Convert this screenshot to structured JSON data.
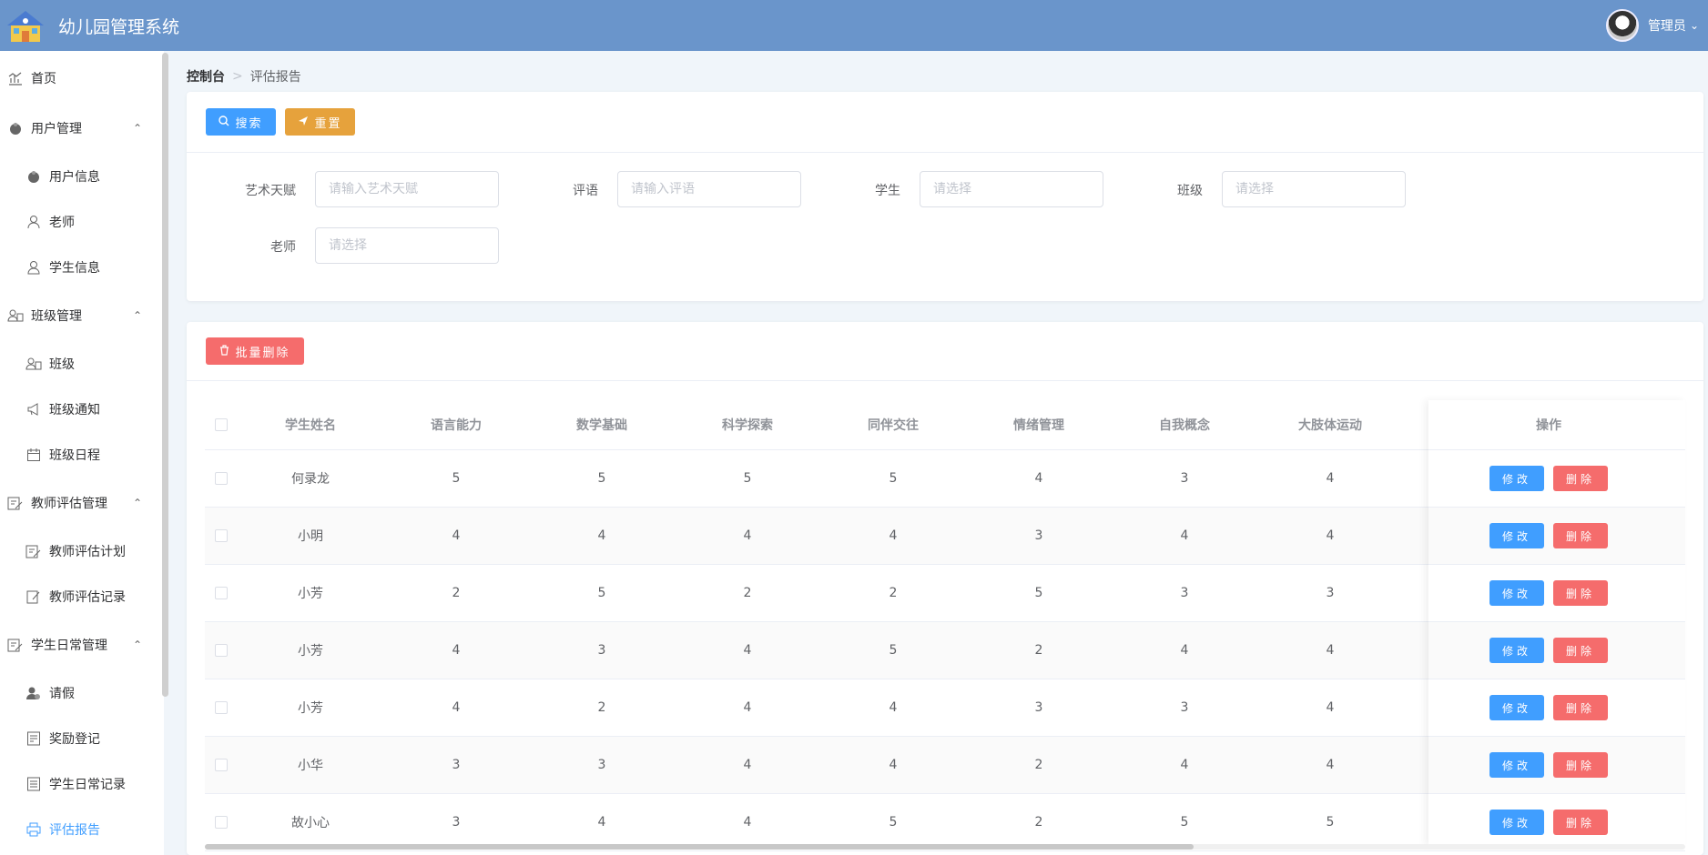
{
  "header": {
    "title": "幼儿园管理系统",
    "user_name": "管理员"
  },
  "sidebar": {
    "items": [
      {
        "label": "首页",
        "icon": "chart-icon",
        "level": "top"
      },
      {
        "label": "用户管理",
        "icon": "user-group-icon",
        "level": "top",
        "expanded": true
      },
      {
        "label": "用户信息",
        "icon": "user-icon",
        "level": "sub"
      },
      {
        "label": "老师",
        "icon": "teacher-icon",
        "level": "sub"
      },
      {
        "label": "学生信息",
        "icon": "student-icon",
        "level": "sub"
      },
      {
        "label": "班级管理",
        "icon": "class-icon",
        "level": "top",
        "expanded": true
      },
      {
        "label": "班级",
        "icon": "class-icon",
        "level": "sub"
      },
      {
        "label": "班级通知",
        "icon": "megaphone-icon",
        "level": "sub"
      },
      {
        "label": "班级日程",
        "icon": "calendar-icon",
        "level": "sub"
      },
      {
        "label": "教师评估管理",
        "icon": "edit-icon",
        "level": "top",
        "expanded": true
      },
      {
        "label": "教师评估计划",
        "icon": "edit-icon",
        "level": "sub"
      },
      {
        "label": "教师评估记录",
        "icon": "edit-icon",
        "level": "sub"
      },
      {
        "label": "学生日常管理",
        "icon": "edit-icon",
        "level": "top",
        "expanded": true
      },
      {
        "label": "请假",
        "icon": "person-icon",
        "level": "sub"
      },
      {
        "label": "奖励登记",
        "icon": "document-icon",
        "level": "sub"
      },
      {
        "label": "学生日常记录",
        "icon": "document-icon",
        "level": "sub"
      },
      {
        "label": "评估报告",
        "icon": "printer-icon",
        "level": "sub",
        "active": true
      }
    ]
  },
  "breadcrumb": {
    "home": "控制台",
    "current": "评估报告"
  },
  "toolbar": {
    "search_label": "搜索",
    "reset_label": "重置",
    "batch_delete_label": "批量删除"
  },
  "search_form": {
    "art_label": "艺术天赋",
    "art_placeholder": "请输入艺术天赋",
    "comment_label": "评语",
    "comment_placeholder": "请输入评语",
    "student_label": "学生",
    "student_placeholder": "请选择",
    "class_label": "班级",
    "class_placeholder": "请选择",
    "teacher_label": "老师",
    "teacher_placeholder": "请选择"
  },
  "table": {
    "columns": [
      "学生姓名",
      "语言能力",
      "数学基础",
      "科学探索",
      "同伴交往",
      "情绪管理",
      "自我概念",
      "大肢体运动",
      "操作"
    ],
    "edit_label": "修改",
    "delete_label": "删除",
    "rows": [
      {
        "name": "何录龙",
        "scores": [
          "5",
          "5",
          "5",
          "5",
          "4",
          "3",
          "4"
        ]
      },
      {
        "name": "小明",
        "scores": [
          "4",
          "4",
          "4",
          "4",
          "3",
          "4",
          "4"
        ]
      },
      {
        "name": "小芳",
        "scores": [
          "2",
          "5",
          "2",
          "2",
          "5",
          "3",
          "3"
        ]
      },
      {
        "name": "小芳",
        "scores": [
          "4",
          "3",
          "4",
          "5",
          "2",
          "4",
          "4"
        ]
      },
      {
        "name": "小芳",
        "scores": [
          "4",
          "2",
          "4",
          "4",
          "3",
          "3",
          "4"
        ]
      },
      {
        "name": "小华",
        "scores": [
          "3",
          "3",
          "4",
          "4",
          "2",
          "4",
          "4"
        ]
      },
      {
        "name": "故小心",
        "scores": [
          "3",
          "4",
          "4",
          "5",
          "2",
          "5",
          "5"
        ]
      }
    ]
  },
  "colors": {
    "header_bg": "#6a95cb",
    "primary": "#409eff",
    "warning": "#e6a23c",
    "danger": "#f56c6c"
  }
}
